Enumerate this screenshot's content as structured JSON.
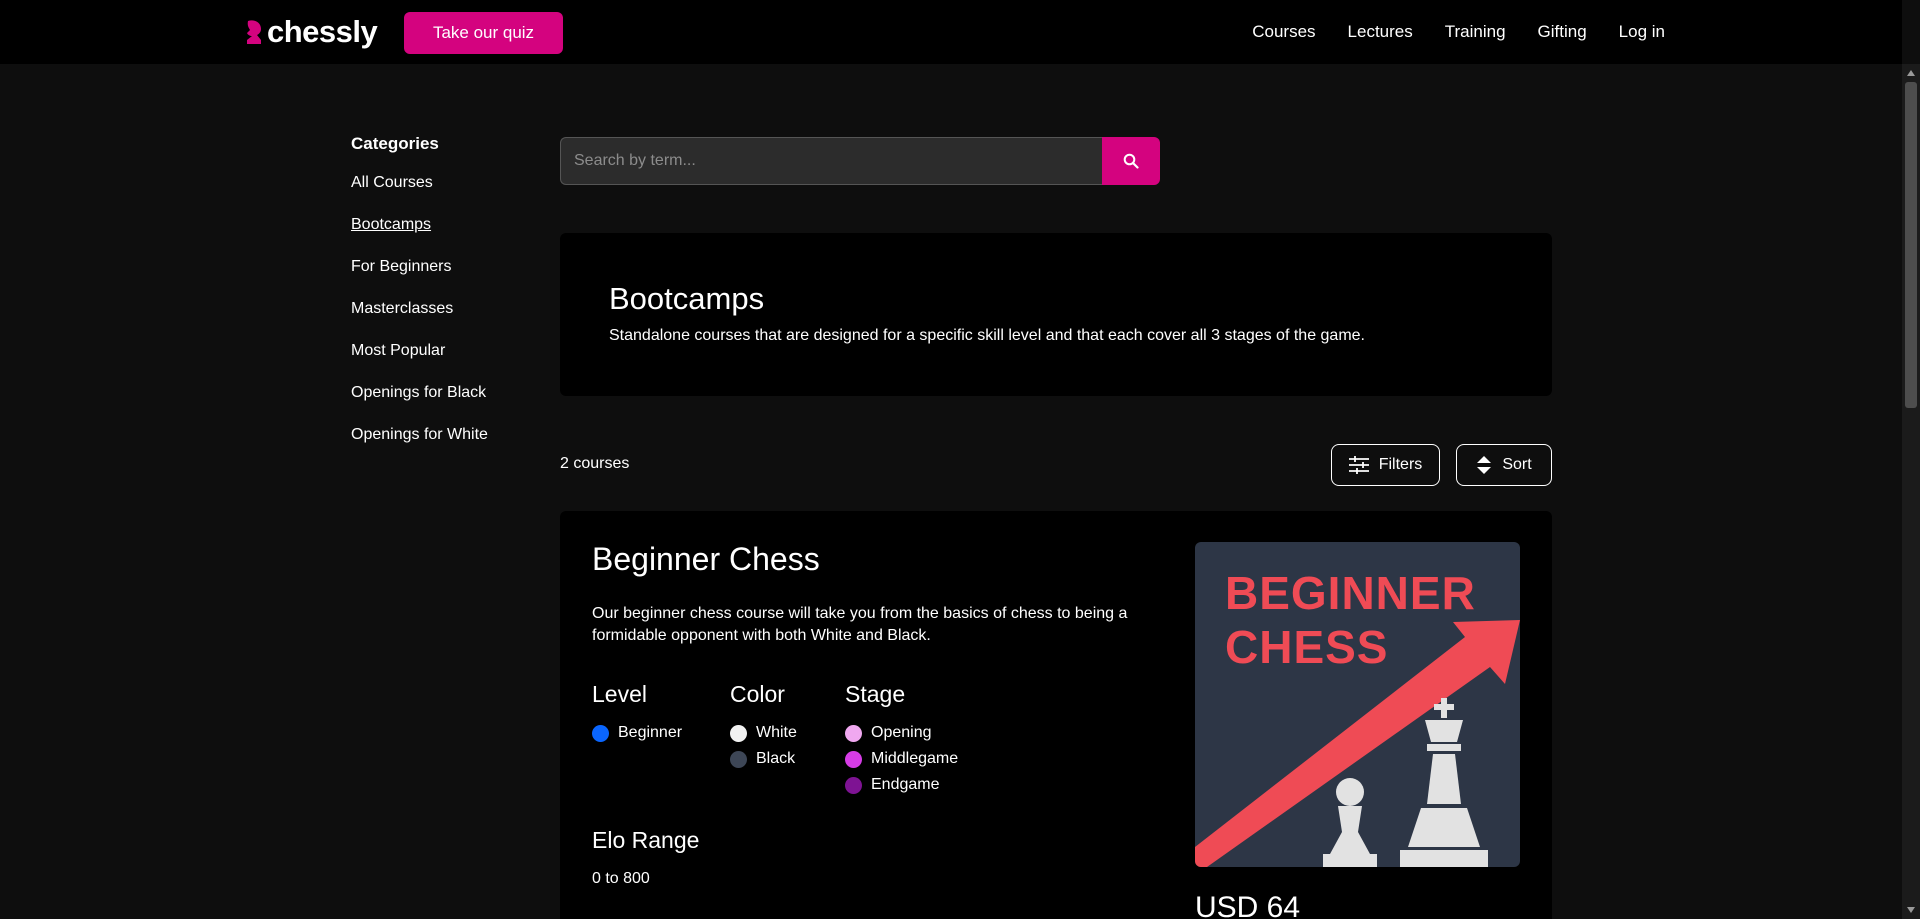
{
  "header": {
    "logo_text": "chessly",
    "quiz_button": "Take our quiz",
    "nav": [
      "Courses",
      "Lectures",
      "Training",
      "Gifting",
      "Log in"
    ]
  },
  "sidebar": {
    "title": "Categories",
    "items": [
      {
        "label": "All Courses",
        "active": false
      },
      {
        "label": "Bootcamps",
        "active": true
      },
      {
        "label": "For Beginners",
        "active": false
      },
      {
        "label": "Masterclasses",
        "active": false
      },
      {
        "label": "Most Popular",
        "active": false
      },
      {
        "label": "Openings for Black",
        "active": false
      },
      {
        "label": "Openings for White",
        "active": false
      }
    ]
  },
  "search": {
    "placeholder": "Search by term..."
  },
  "banner": {
    "title": "Bootcamps",
    "description": "Standalone courses that are designed for a specific skill level and that each cover all 3 stages of the game."
  },
  "results": {
    "count": "2 courses",
    "filters_label": "Filters",
    "sort_label": "Sort"
  },
  "course": {
    "title": "Beginner Chess",
    "description": "Our beginner chess course will take you from the basics of chess to being a formidable opponent with both White and Black.",
    "level": {
      "title": "Level",
      "items": [
        {
          "label": "Beginner",
          "color": "#0a66ff"
        }
      ]
    },
    "color": {
      "title": "Color",
      "items": [
        {
          "label": "White",
          "color": "#f2f2f2"
        },
        {
          "label": "Black",
          "color": "#3d4656"
        }
      ]
    },
    "stage": {
      "title": "Stage",
      "items": [
        {
          "label": "Opening",
          "color": "#f0a8f0"
        },
        {
          "label": "Middlegame",
          "color": "#d63ce6"
        },
        {
          "label": "Endgame",
          "color": "#7e1393"
        }
      ]
    },
    "elo_title": "Elo Range",
    "elo_value": "0 to 800",
    "thumbnail_line1": "BEGINNER",
    "thumbnail_line2": "CHESS",
    "price": "USD 64"
  },
  "colors": {
    "accent": "#d4037f",
    "header_bg": "#000000",
    "page_bg": "#0e0e0e",
    "thumb_bg": "#2d3646",
    "thumb_red": "#ef4b55"
  }
}
